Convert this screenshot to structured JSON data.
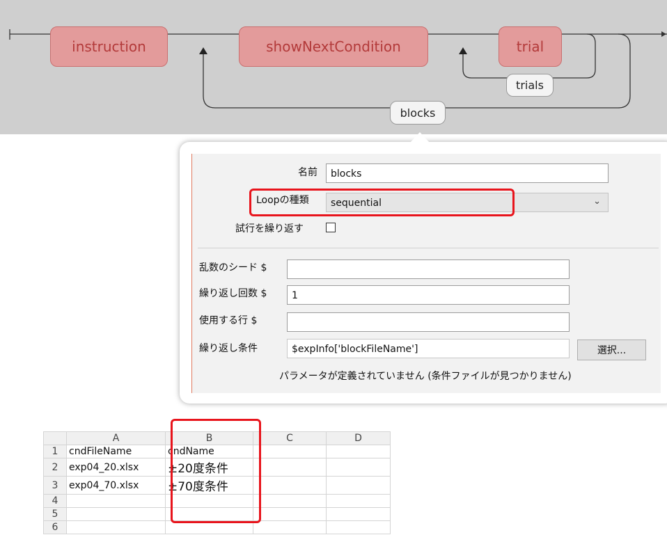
{
  "flow": {
    "routines": [
      "instruction",
      "showNextCondition",
      "trial"
    ],
    "loops": [
      "trials",
      "blocks"
    ],
    "routine_color": "#e39b9b",
    "routine_text_color": "#b33a3a"
  },
  "dialog": {
    "name_label": "名前",
    "name_value": "blocks",
    "loop_type_label": "Loopの種類",
    "loop_type_value": "sequential",
    "repeat_trials_label": "試行を繰り返す",
    "seed_label": "乱数のシード $",
    "seed_value": "",
    "nreps_label": "繰り返し回数 $",
    "nreps_value": "1",
    "rows_label": "使用する行 $",
    "rows_value": "",
    "conditions_label": "繰り返し条件",
    "conditions_value": "$expInfo['blockFileName']",
    "browse_button": "選択...",
    "status_message": "パラメータが定義されていません (条件ファイルが見つかりません)",
    "highlight_color": "#e8141c"
  },
  "sheet": {
    "columns": [
      "A",
      "B",
      "C",
      "D"
    ],
    "rows": [
      {
        "num": "1",
        "cells": [
          "cndFileName",
          "cndName",
          "",
          ""
        ]
      },
      {
        "num": "2",
        "cells": [
          "exp04_20.xlsx",
          "±20度条件",
          "",
          ""
        ]
      },
      {
        "num": "3",
        "cells": [
          "exp04_70.xlsx",
          "±70度条件",
          "",
          ""
        ]
      },
      {
        "num": "4",
        "cells": [
          "",
          "",
          "",
          ""
        ]
      },
      {
        "num": "5",
        "cells": [
          "",
          "",
          "",
          ""
        ]
      },
      {
        "num": "6",
        "cells": [
          "",
          "",
          "",
          ""
        ]
      }
    ]
  }
}
